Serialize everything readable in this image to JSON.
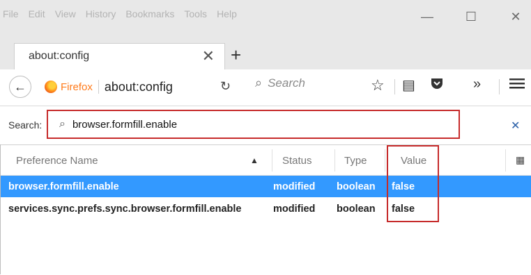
{
  "menu": {
    "items": [
      "File",
      "Edit",
      "View",
      "History",
      "Bookmarks",
      "Tools",
      "Help"
    ]
  },
  "window_controls": {
    "minimize": "—",
    "maximize": "☐",
    "close": "✕"
  },
  "tab": {
    "title": "about:config",
    "close": "✕",
    "new_tab": "+"
  },
  "nav": {
    "back": "←",
    "identity_label": "Firefox",
    "url": "about:config",
    "reload": "↻",
    "search_placeholder": "Search",
    "more": "»"
  },
  "config": {
    "search_label": "Search:",
    "search_value": "browser.formfill.enable",
    "clear": "✕"
  },
  "table": {
    "columns": [
      "Preference Name",
      "Status",
      "Type",
      "Value"
    ],
    "sort_indicator": "▲",
    "rows": [
      {
        "name": "browser.formfill.enable",
        "status": "modified",
        "type": "boolean",
        "value": "false",
        "selected": true
      },
      {
        "name": "services.sync.prefs.sync.browser.formfill.enable",
        "status": "modified",
        "type": "boolean",
        "value": "false",
        "selected": false
      }
    ]
  },
  "colors": {
    "selection": "#3399ff",
    "highlight_border": "#c62a2a",
    "firefox_orange": "#ff7a1a"
  }
}
